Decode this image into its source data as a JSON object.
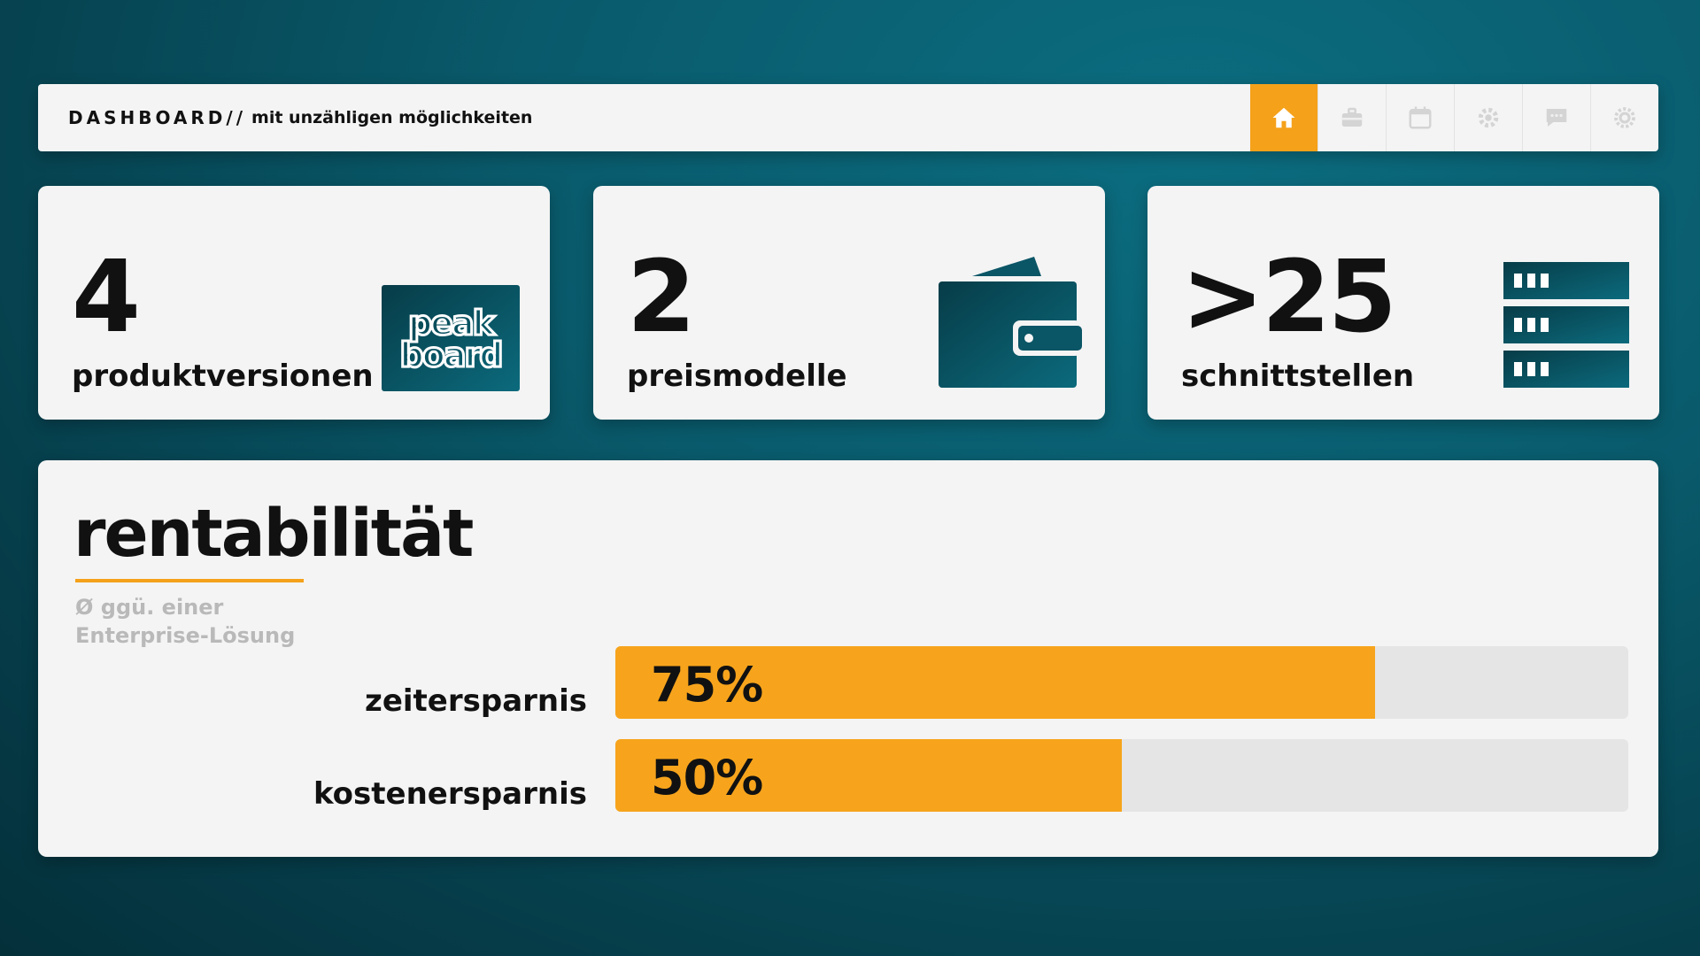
{
  "header": {
    "brand": "DASHBOARD//",
    "subtitle": "mit unzähligen möglichkeiten",
    "nav_icons": [
      "home-icon",
      "briefcase-icon",
      "calendar-icon",
      "gear-icon",
      "chat-icon",
      "settings-icon"
    ],
    "active_nav": "home-icon"
  },
  "kpis": [
    {
      "value": "4",
      "label": "produktversionen",
      "icon": "peakboard-logo",
      "logo_text": "peak board"
    },
    {
      "value": "2",
      "label": "preismodelle",
      "icon": "wallet-icon"
    },
    {
      "value": ">25",
      "label": "schnittstellen",
      "icon": "server-icon"
    }
  ],
  "rentabilitaet": {
    "title": "rentabilität",
    "subtitle_line1": "Ø ggü. einer",
    "subtitle_line2": "Enterprise-Lösung",
    "bars": [
      {
        "label": "zeitersparnis",
        "value_text": "75%",
        "value": 0.75
      },
      {
        "label": "kostenersparnis",
        "value_text": "50%",
        "value": 0.5
      }
    ]
  },
  "colors": {
    "accent": "#f5a11a",
    "background": "#095a6b",
    "card": "#f4f4f4",
    "icon_teal": "#0a5566"
  }
}
